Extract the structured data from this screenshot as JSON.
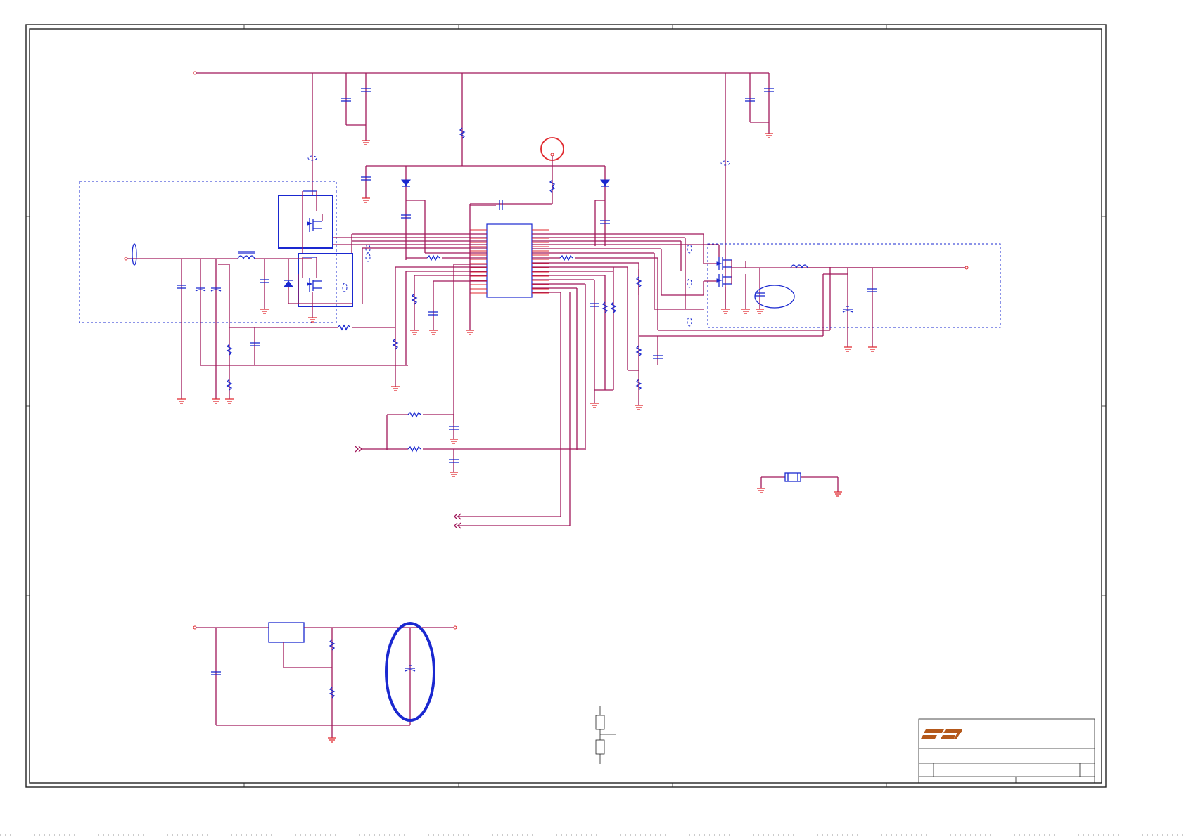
{
  "document": {
    "type": "schematic",
    "logo_text": "FIC"
  },
  "colors": {
    "wire": "#a0185a",
    "bus": "#e0282d",
    "component": "#1a28d0",
    "highlight_red": "#e0282d",
    "highlight_blue": "#1a28d0",
    "logo": "#b4581a"
  }
}
